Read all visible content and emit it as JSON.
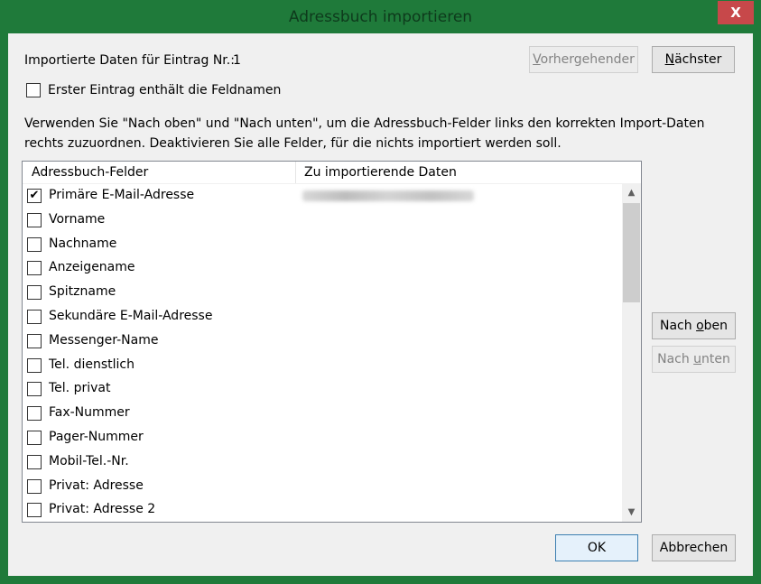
{
  "window": {
    "title": "Adressbuch importieren",
    "close_label": "X"
  },
  "entry": {
    "label": "Importierte Daten für Eintrag Nr.:",
    "number": "1"
  },
  "buttons": {
    "previous": "Vorhergehender",
    "next": "Nächster",
    "up": "Nach oben",
    "down": "Nach unten",
    "ok": "OK",
    "cancel": "Abbrechen"
  },
  "first_row_checkbox": {
    "label": "Erster Eintrag enthält die Feldnamen",
    "checked": false
  },
  "instructions": "Verwenden Sie \"Nach oben\" und \"Nach unten\", um die Adressbuch-Felder links den korrekten Import-Daten rechts zuzuordnen. Deaktivieren Sie alle Felder, für die nichts importiert werden soll.",
  "list": {
    "columns": [
      "Adressbuch-Felder",
      "Zu importierende Daten"
    ],
    "rows": [
      {
        "label": "Primäre E-Mail-Adresse",
        "checked": true
      },
      {
        "label": "Vorname",
        "checked": false
      },
      {
        "label": "Nachname",
        "checked": false
      },
      {
        "label": "Anzeigename",
        "checked": false
      },
      {
        "label": "Spitzname",
        "checked": false
      },
      {
        "label": "Sekundäre E-Mail-Adresse",
        "checked": false
      },
      {
        "label": "Messenger-Name",
        "checked": false
      },
      {
        "label": "Tel. dienstlich",
        "checked": false
      },
      {
        "label": "Tel. privat",
        "checked": false
      },
      {
        "label": "Fax-Nummer",
        "checked": false
      },
      {
        "label": "Pager-Nummer",
        "checked": false
      },
      {
        "label": "Mobil-Tel.-Nr.",
        "checked": false
      },
      {
        "label": "Privat: Adresse",
        "checked": false
      },
      {
        "label": "Privat: Adresse 2",
        "checked": false
      }
    ]
  }
}
